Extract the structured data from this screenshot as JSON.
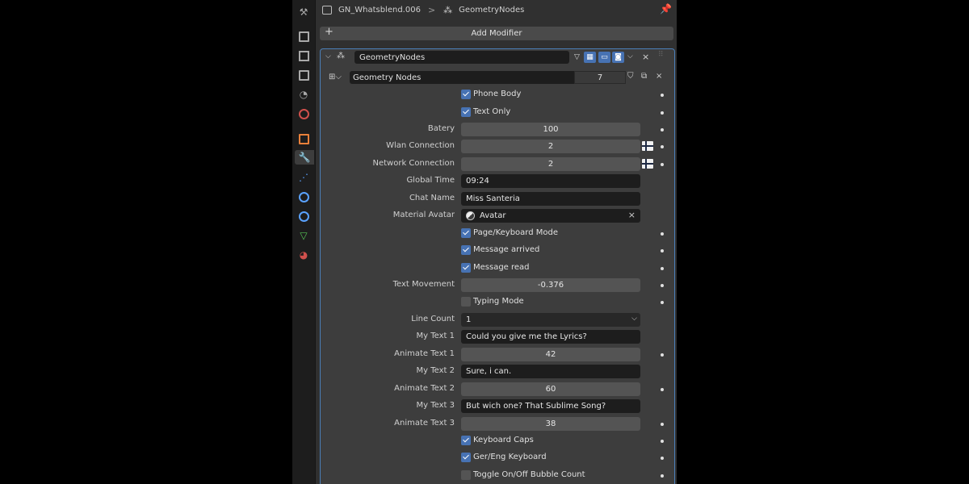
{
  "header": {
    "object_name": "GN_Whatsblend.006",
    "separator": ">",
    "modifier_name": "GeometryNodes"
  },
  "tabs": [
    {
      "name": "tool-tab",
      "glyph": "🔧"
    },
    {
      "name": "render-tab"
    },
    {
      "name": "output-tab"
    },
    {
      "name": "view-layer-tab"
    },
    {
      "name": "scene-tab"
    },
    {
      "name": "world-tab"
    },
    {
      "name": "object-tab"
    },
    {
      "name": "modifier-tab",
      "active": true
    },
    {
      "name": "particles-tab"
    },
    {
      "name": "physics-tab"
    },
    {
      "name": "constraints-tab"
    },
    {
      "name": "data-tab"
    },
    {
      "name": "material-tab"
    }
  ],
  "add_modifier": {
    "plus": "+",
    "label": "Add Modifier"
  },
  "modifier": {
    "name": "GeometryNodes",
    "node_group": "Geometry Nodes",
    "users": "7",
    "close": "×"
  },
  "properties": [
    {
      "kind": "check",
      "label": "Phone Body",
      "checked": true,
      "dot": true
    },
    {
      "kind": "check",
      "label": "Text Only",
      "checked": true,
      "dot": true
    },
    {
      "kind": "num",
      "label": "Batery",
      "value": "100",
      "dot": true
    },
    {
      "kind": "num",
      "label": "Wlan Connection",
      "value": "2",
      "flag": true,
      "dot": true
    },
    {
      "kind": "num",
      "label": "Network Connection",
      "value": "2",
      "flag": true,
      "dot": true
    },
    {
      "kind": "text",
      "label": "Global Time",
      "value": "09:24"
    },
    {
      "kind": "text",
      "label": "Chat Name",
      "value": "Miss Santeria"
    },
    {
      "kind": "material",
      "label": "Material Avatar",
      "value": "Avatar"
    },
    {
      "kind": "check",
      "label": "Page/Keyboard Mode",
      "checked": true,
      "dot": true
    },
    {
      "kind": "check",
      "label": "Message arrived",
      "checked": true,
      "dot": true
    },
    {
      "kind": "check",
      "label": "Message read",
      "checked": true,
      "dot": true
    },
    {
      "kind": "num",
      "label": "Text Movement",
      "value": "-0.376",
      "dot": true
    },
    {
      "kind": "check",
      "label": "Typing Mode",
      "checked": false,
      "dot": true
    },
    {
      "kind": "enum",
      "label": "Line Count",
      "value": "1"
    },
    {
      "kind": "text",
      "label": "My Text 1",
      "value": "Could you give me the Lyrics?"
    },
    {
      "kind": "num",
      "label": "Animate Text 1",
      "value": "42",
      "dot": true
    },
    {
      "kind": "text",
      "label": "My Text 2",
      "value": "Sure, i can."
    },
    {
      "kind": "num",
      "label": "Animate Text 2",
      "value": "60",
      "dot": true
    },
    {
      "kind": "text",
      "label": "My Text 3",
      "value": "But wich one? That Sublime Song?"
    },
    {
      "kind": "num",
      "label": "Animate Text 3",
      "value": "38",
      "dot": true
    },
    {
      "kind": "check",
      "label": "Keyboard Caps",
      "checked": true,
      "dot": true
    },
    {
      "kind": "check",
      "label": "Ger/Eng Keyboard",
      "checked": true,
      "dot": true
    },
    {
      "kind": "check",
      "label": "Toggle On/Off Bubble Count",
      "checked": false,
      "dot": true
    }
  ],
  "colors": {
    "accent": "#4772b3",
    "panel": "#303030",
    "field": "#545454",
    "text_field": "#1d1d1d"
  }
}
